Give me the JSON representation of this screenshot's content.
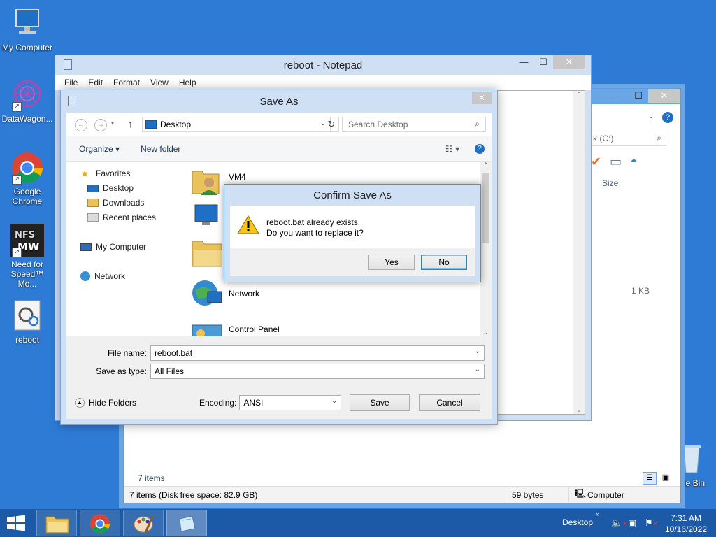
{
  "desktop": {
    "icons": [
      {
        "label": "My Computer"
      },
      {
        "label": "DataWagon..."
      },
      {
        "label": "Google Chrome"
      },
      {
        "label": "Need for Speed™ Mo..."
      },
      {
        "label": "reboot"
      },
      {
        "label": "cle Bin"
      }
    ]
  },
  "explorer": {
    "search_placeholder": "k (C:)",
    "column_size": "Size",
    "file_size": "1 KB",
    "items_count": "7 items",
    "status_left": "7 items (Disk free space: 82.9 GB)",
    "status_size": "59 bytes",
    "status_location": "Computer"
  },
  "notepad": {
    "title": "reboot - Notepad",
    "menu": [
      "File",
      "Edit",
      "Format",
      "View",
      "Help"
    ]
  },
  "save_as": {
    "title": "Save As",
    "address": "Desktop",
    "search_placeholder": "Search Desktop",
    "organize": "Organize ▾",
    "new_folder": "New folder",
    "nav": {
      "favorites": "Favorites",
      "desktop": "Desktop",
      "downloads": "Downloads",
      "recent": "Recent places",
      "my_computer": "My Computer",
      "network": "Network"
    },
    "files": [
      "VM4",
      "Network",
      "Control Panel"
    ],
    "file_name_label": "File name:",
    "file_name": "reboot.bat",
    "save_type_label": "Save as type:",
    "save_type": "All Files",
    "hide_folders": "Hide Folders",
    "encoding_label": "Encoding:",
    "encoding": "ANSI",
    "save_button": "Save",
    "cancel_button": "Cancel"
  },
  "confirm": {
    "title": "Confirm Save As",
    "line1": "reboot.bat already exists.",
    "line2": "Do you want to replace it?",
    "yes": "Yes",
    "no": "No"
  },
  "taskbar": {
    "desktop_label": "Desktop",
    "time": "7:31 AM",
    "date": "10/16/2022"
  }
}
